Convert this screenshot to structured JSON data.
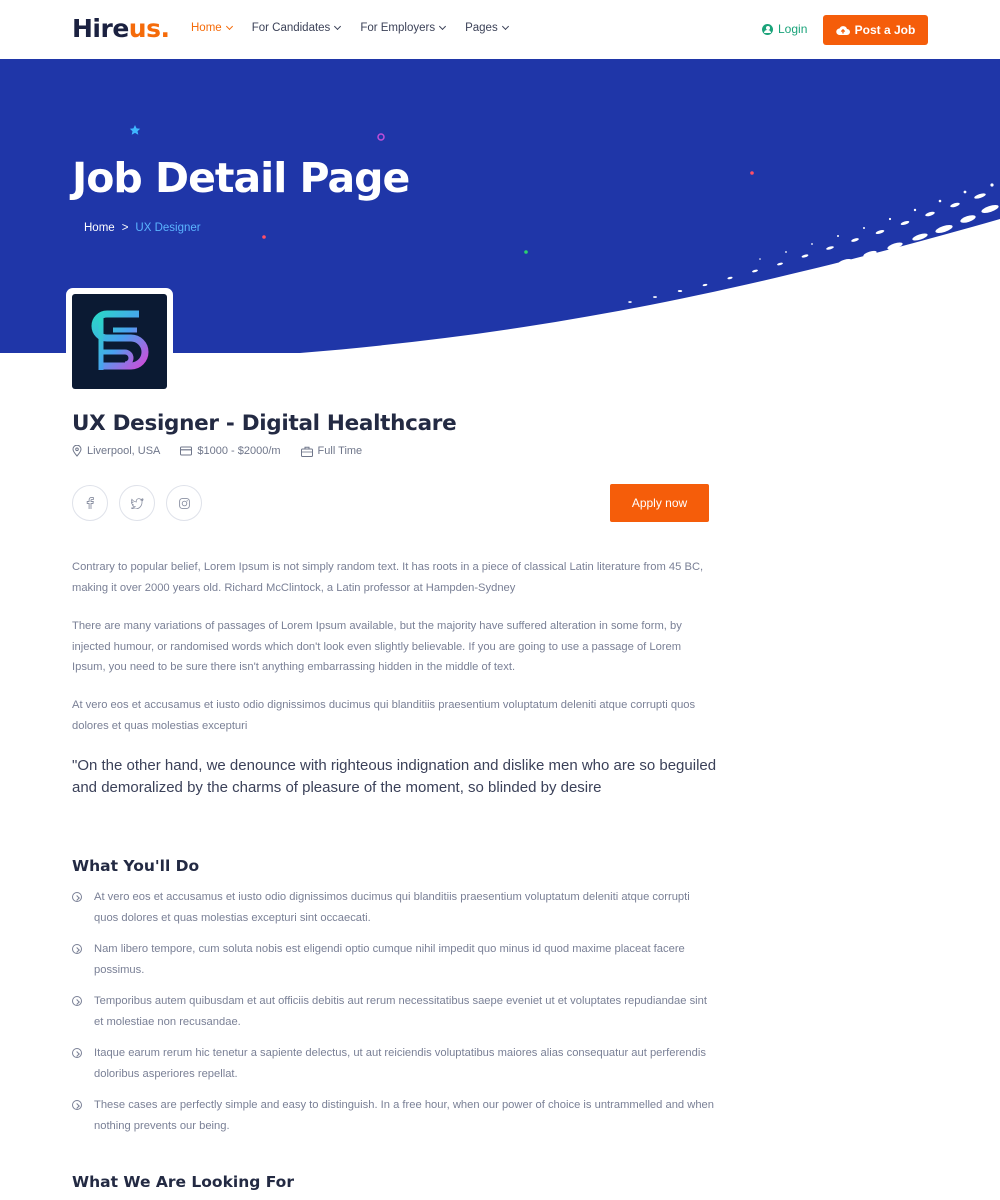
{
  "header": {
    "logo_part1": "Hire",
    "logo_part2": "us.",
    "nav": [
      {
        "label": "Home",
        "active": true
      },
      {
        "label": "For Candidates",
        "active": false
      },
      {
        "label": "For Employers",
        "active": false
      },
      {
        "label": "Pages",
        "active": false
      }
    ],
    "login_label": "Login",
    "post_job_label": "Post a Job"
  },
  "hero": {
    "title": "Job Detail Page",
    "breadcrumb_home": "Home",
    "breadcrumb_separator": ">",
    "breadcrumb_current": "UX Designer"
  },
  "job": {
    "title": "UX Designer - Digital Healthcare",
    "location": "Liverpool, USA",
    "salary": "$1000 - $2000/m",
    "type": "Full Time",
    "apply_label": "Apply now"
  },
  "description": {
    "p1": "Contrary to popular belief, Lorem Ipsum is not simply random text. It has roots in a piece of classical Latin literature from 45 BC, making it over 2000 years old. Richard McClintock, a Latin professor at Hampden-Sydney",
    "p2": "There are many variations of passages of Lorem Ipsum available, but the majority have suffered alteration in some form, by injected humour, or randomised words which don't look even slightly believable. If you are going to use a passage of Lorem Ipsum, you need to be sure there isn't anything embarrassing hidden in the middle of text.",
    "p3": "At vero eos et accusamus et iusto odio dignissimos ducimus qui blanditiis praesentium voluptatum deleniti atque corrupti quos dolores et quas molestias excepturi",
    "quote": "\"On the other hand, we denounce with righteous indignation and dislike men who are so beguiled and demoralized by the charms of pleasure of the moment, so blinded by desire"
  },
  "what_youll_do": {
    "heading": "What You'll Do",
    "items": [
      "At vero eos et accusamus et iusto odio dignissimos ducimus qui blanditiis praesentium voluptatum deleniti atque corrupti quos dolores et quas molestias excepturi sint occaecati.",
      "Nam libero tempore, cum soluta nobis est eligendi optio cumque nihil impedit quo minus id quod maxime placeat facere possimus.",
      "Temporibus autem quibusdam et aut officiis debitis aut rerum necessitatibus saepe eveniet ut et voluptates repudiandae sint et molestiae non recusandae.",
      "Itaque earum rerum hic tenetur a sapiente delectus, ut aut reiciendis voluptatibus maiores alias consequatur aut perferendis doloribus asperiores repellat.",
      "These cases are perfectly simple and easy to distinguish. In a free hour, when our power of choice is untrammelled and when nothing prevents our being."
    ]
  },
  "looking_for": {
    "heading": "What We Are Looking For"
  },
  "colors": {
    "accent": "#f55d0a",
    "hero": "#1f36a8",
    "login": "#1aa37a",
    "breadcrumb_current": "#5bb4ff"
  }
}
